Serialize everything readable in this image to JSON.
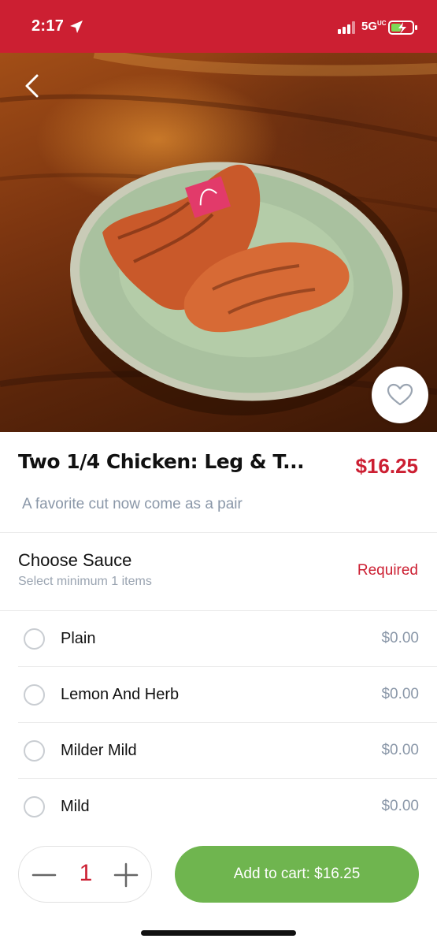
{
  "status_bar": {
    "time": "2:17",
    "network": "5G",
    "network_superscript": "UC",
    "color": "#cc1f32"
  },
  "hero": {
    "back_icon": "chevron-left-icon",
    "favorite_icon": "heart-outline-icon"
  },
  "product": {
    "title": "Two 1/4 Chicken: Leg & T...",
    "price": "$16.25",
    "description": "A favorite cut now come as a pair"
  },
  "sauce_section": {
    "title": "Choose Sauce",
    "subtitle": "Select minimum 1 items",
    "required_label": "Required",
    "options": [
      {
        "label": "Plain",
        "price": "$0.00"
      },
      {
        "label": "Lemon And Herb",
        "price": "$0.00"
      },
      {
        "label": "Milder Mild",
        "price": "$0.00"
      },
      {
        "label": "Mild",
        "price": "$0.00"
      }
    ]
  },
  "cart": {
    "quantity": "1",
    "add_button_label": "Add to cart: $16.25",
    "button_color": "#6fb54f"
  },
  "colors": {
    "accent": "#cc1f32",
    "muted_text": "#8a97a8"
  }
}
